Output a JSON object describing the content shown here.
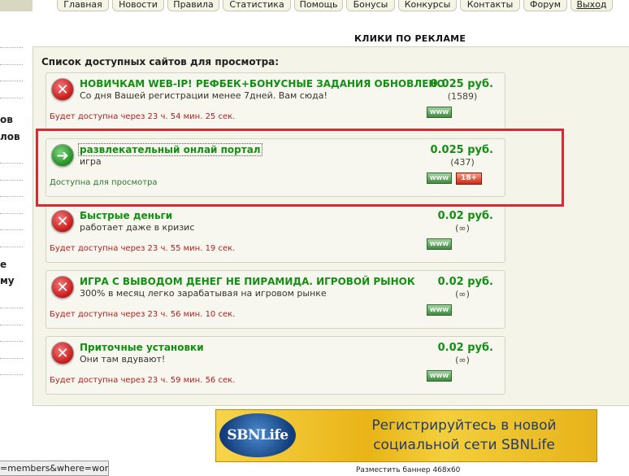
{
  "nav": {
    "tabs": [
      "Главная",
      "Новости",
      "Правила",
      "Статистика",
      "Помощь",
      "Бонусы",
      "Конкурсы",
      "Контакты",
      "Форум",
      "Выход"
    ]
  },
  "sidebar": {
    "fragments": [
      "ов",
      "лов",
      "е",
      "му"
    ]
  },
  "page": {
    "heading": "КЛИКИ ПО РЕКЛАМЕ",
    "list_title": "Список доступных сайтов для просмотра:"
  },
  "sites": [
    {
      "title": "НОВИЧКАМ WEB-IP! РЕФБЕК+БОНУСНЫЕ ЗАДАНИЯ ОБНОВЛЕНО",
      "description": "Со дня Вашей регистрации менее 7дней. Вам сюда!",
      "status": "Будет доступна через 23 ч. 54 мин. 25 сек.",
      "price": "0.025 руб.",
      "views": "(1589)",
      "www_label": "WWW",
      "icon": "error-icon",
      "available": false
    },
    {
      "title": "развлекательный онлай портал",
      "description": "игра",
      "status": "Доступна для просмотра",
      "price": "0.025 руб.",
      "views": "(437)",
      "www_label": "WWW",
      "adult_label": "18+",
      "icon": "arrow-right-icon",
      "available": true
    },
    {
      "title": "Быстрые деньги",
      "description": "работает даже в кризис",
      "status": "Будет доступна через 23 ч. 55 мин. 19 сек.",
      "price": "0.02 руб.",
      "views": "(∞)",
      "www_label": "WWW",
      "icon": "error-icon",
      "available": false
    },
    {
      "title": "ИГРА С ВЫВОДОМ ДЕНЕГ НЕ ПИРАМИДА. ИГРОВОЙ РЫНОК",
      "description": "300% в месяц легко зарабатывая на игровом рынке",
      "status": "Будет доступна через 23 ч. 56 мин. 10 сек.",
      "price": "0.02 руб.",
      "views": "(∞)",
      "www_label": "WWW",
      "icon": "error-icon",
      "available": false
    },
    {
      "title": "Приточные установки",
      "description": "Они там вдувают!",
      "status": "Будет доступна через 23 ч. 59 мин. 56 сек.",
      "price": "0.02 руб.",
      "views": "(∞)",
      "www_label": "WWW",
      "icon": "error-icon",
      "available": false
    }
  ],
  "banner": {
    "logo": "SBNLife",
    "line1": "Регистрируйтесь в новой",
    "line2": "социальной сети SBNLife",
    "caption": "Разместить баннер 468x60"
  },
  "statusbar": {
    "url": "=members&where=work"
  },
  "colors": {
    "title_green": "#139013",
    "timer_red": "#b02020",
    "available_green": "#2a7a2a",
    "highlight_red": "#d62b36"
  }
}
